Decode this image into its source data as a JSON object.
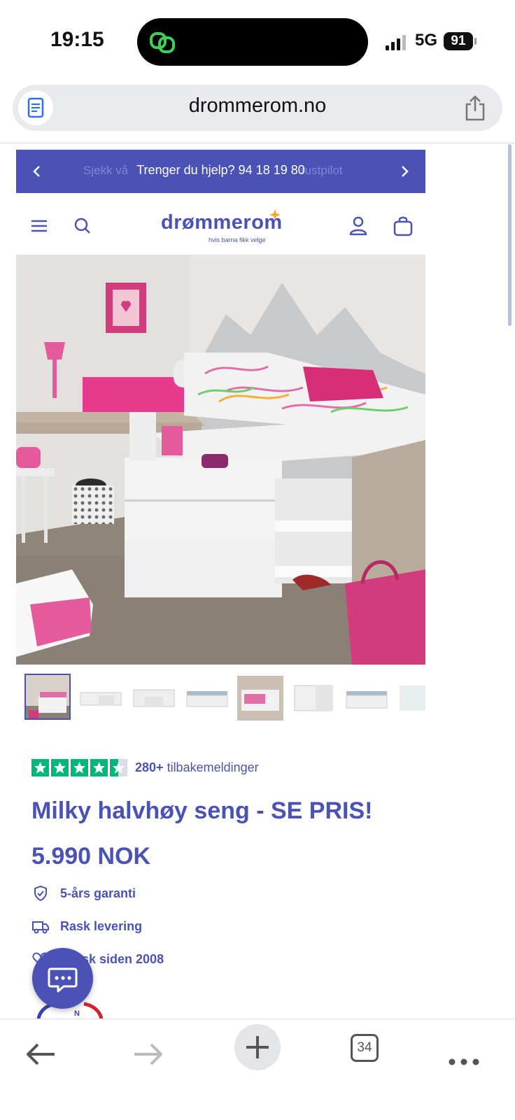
{
  "status_bar": {
    "time": "19:15",
    "network": "5G",
    "battery": "91"
  },
  "browser": {
    "url": "drommerom.no",
    "tab_count": "34"
  },
  "promo_banner": {
    "text": "Trenger du hjelp? 94 18 19 80",
    "ghost_left": "Sjekk vå",
    "ghost_right": "rustpilot"
  },
  "logo": {
    "name": "drømmerom",
    "tagline": "hvis barna fikk velge"
  },
  "product": {
    "rating_stars": 4.5,
    "reviews_count": "280+",
    "reviews_label": "tilbakemeldinger",
    "title": "Milky halvhøy seng - SE PRIS!",
    "price": "5.990 NOK",
    "usps": [
      "5-års garanti",
      "Rask levering",
      "Norsk siden 2008"
    ]
  },
  "gallery": {
    "thumbnail_count": 8,
    "active_index": 0
  },
  "icons": [
    "menu-icon",
    "search-icon",
    "account-icon",
    "cart-icon",
    "chat-icon",
    "share-icon",
    "back-icon",
    "forward-icon",
    "plus-icon",
    "more-icon"
  ],
  "colors": {
    "brand": "#4a52b5",
    "trustpilot": "#00b67a"
  }
}
